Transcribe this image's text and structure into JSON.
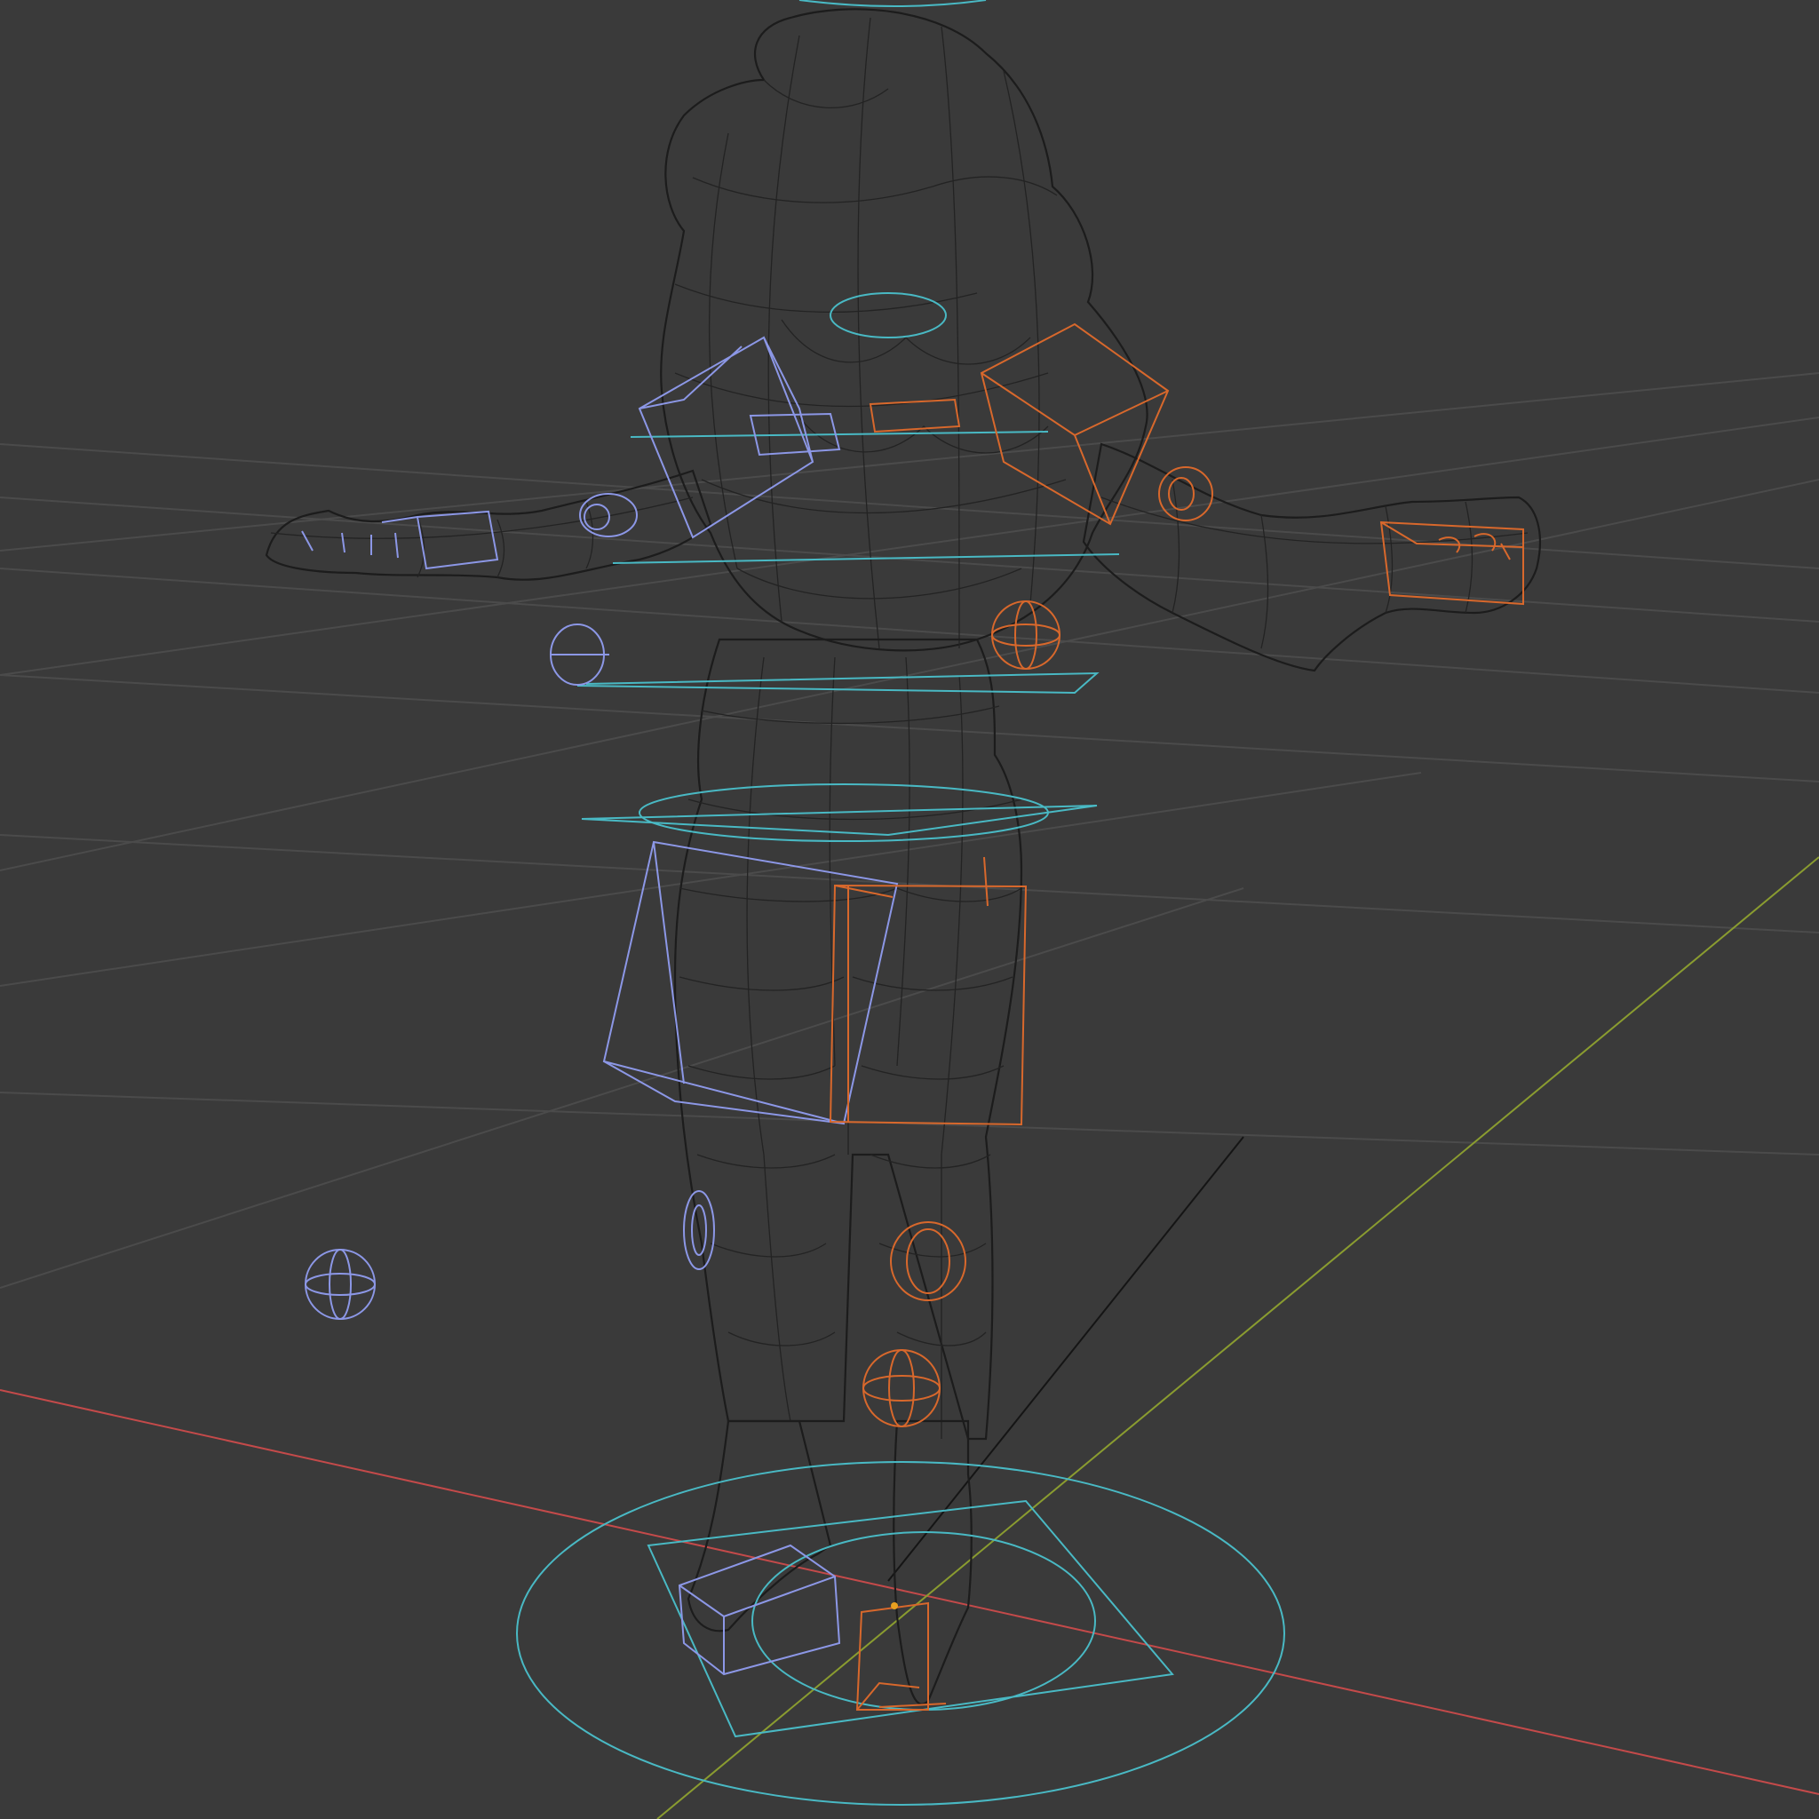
{
  "viewport": {
    "mode": "wireframe",
    "background": "#3a3a3a",
    "grid_color": "#4b4b4b",
    "axis_colors": {
      "x": "#c44a4a",
      "y": "#8a9c30"
    },
    "mesh_color": "#1c1c1c",
    "control_colors": {
      "center": "#49b9c4",
      "left": "#8c97e6",
      "right": "#d8682c"
    }
  }
}
